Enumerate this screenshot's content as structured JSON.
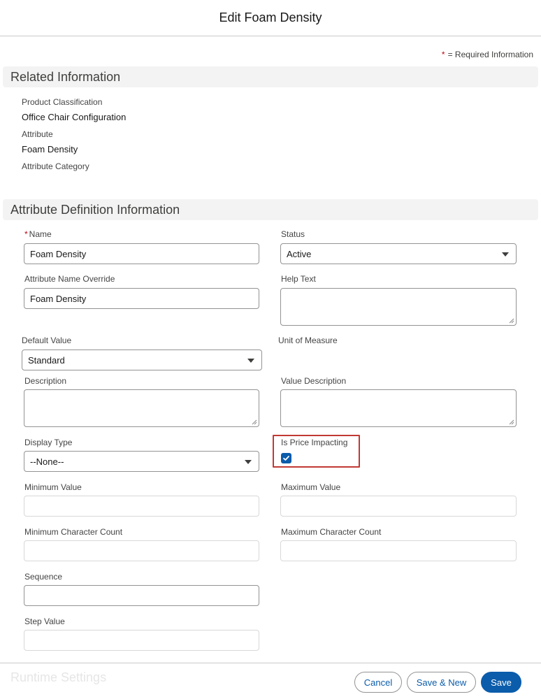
{
  "modal": {
    "title": "Edit Foam Density"
  },
  "required_note": {
    "star": "*",
    "text": "= Required Information"
  },
  "related": {
    "title": "Related Information",
    "fields": [
      {
        "label": "Product Classification",
        "value": "Office Chair Configuration"
      },
      {
        "label": "Attribute",
        "value": "Foam Density"
      },
      {
        "label": "Attribute Category",
        "value": ""
      }
    ]
  },
  "definition": {
    "title": "Attribute Definition Information",
    "name": {
      "required_star": "*",
      "label": "Name",
      "value": "Foam Density"
    },
    "status": {
      "label": "Status",
      "value": "Active"
    },
    "name_override": {
      "label": "Attribute Name Override",
      "value": "Foam Density"
    },
    "help_text": {
      "label": "Help Text",
      "value": ""
    },
    "default_value": {
      "label": "Default Value",
      "value": "Standard"
    },
    "unit_of_measure": {
      "label": "Unit of Measure"
    },
    "description": {
      "label": "Description",
      "value": ""
    },
    "value_description": {
      "label": "Value Description",
      "value": ""
    },
    "display_type": {
      "label": "Display Type",
      "value": "--None--"
    },
    "is_price_impacting": {
      "label": "Is Price Impacting",
      "checked": true
    },
    "minimum_value": {
      "label": "Minimum Value",
      "value": ""
    },
    "maximum_value": {
      "label": "Maximum Value",
      "value": ""
    },
    "min_char_count": {
      "label": "Minimum Character Count",
      "value": ""
    },
    "max_char_count": {
      "label": "Maximum Character Count",
      "value": ""
    },
    "sequence": {
      "label": "Sequence",
      "value": ""
    },
    "step_value": {
      "label": "Step Value",
      "value": ""
    }
  },
  "runtime": {
    "title": "Runtime Settings"
  },
  "footer": {
    "cancel_label": "Cancel",
    "save_new_label": "Save & New",
    "save_label": "Save"
  },
  "colors": {
    "brand": "#0b5cab",
    "required": "#ba0517",
    "highlight": "#c23934"
  }
}
